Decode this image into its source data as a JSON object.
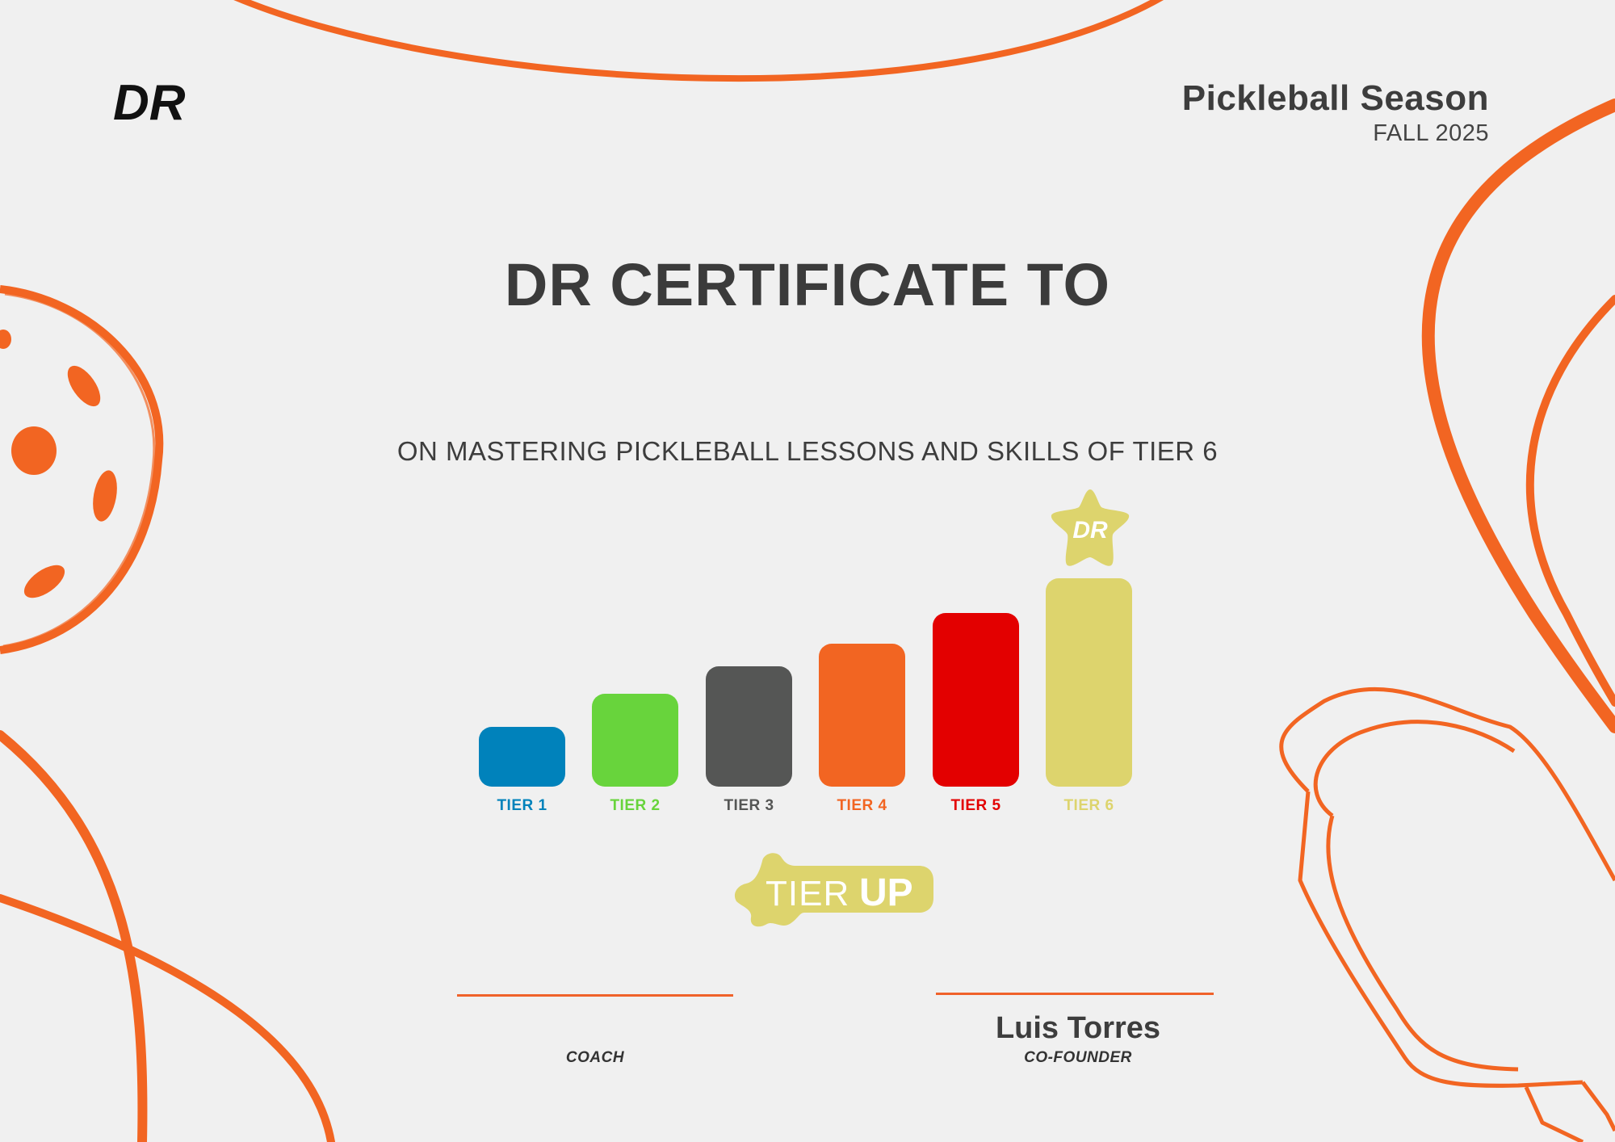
{
  "brand": {
    "logo_text": "DR",
    "accent": "#f26522",
    "text_dark": "#3b3b3b"
  },
  "season": {
    "title": "Pickleball Season",
    "subtitle": "FALL 2025"
  },
  "certificate": {
    "title": "DR CERTIFICATE TO",
    "recipient": "",
    "subtitle": "ON MASTERING PICKLEBALL LESSONS AND SKILLS OF TIER 6"
  },
  "tiers": [
    {
      "label": "TIER 1",
      "level": 1,
      "color": "#0082bb"
    },
    {
      "label": "TIER 2",
      "level": 2,
      "color": "#68d43c"
    },
    {
      "label": "TIER 3",
      "level": 3,
      "color": "#555655"
    },
    {
      "label": "TIER 4",
      "level": 4,
      "color": "#f26522"
    },
    {
      "label": "TIER 5",
      "level": 5,
      "color": "#e30000"
    },
    {
      "label": "TIER 6",
      "level": 6,
      "color": "#ddd46d"
    }
  ],
  "badges": {
    "star_logo_text": "DR",
    "tierup_part1": "TIER",
    "tierup_part2": "UP",
    "badge_color": "#ddd46d"
  },
  "signatures": [
    {
      "name": "",
      "role": "COACH"
    },
    {
      "name": "Luis Torres",
      "role": "CO-FOUNDER"
    }
  ],
  "icons": [
    "dr-logo-icon",
    "pickleball-icon",
    "paddle-icon",
    "star-badge-icon",
    "tierup-badge-icon"
  ]
}
